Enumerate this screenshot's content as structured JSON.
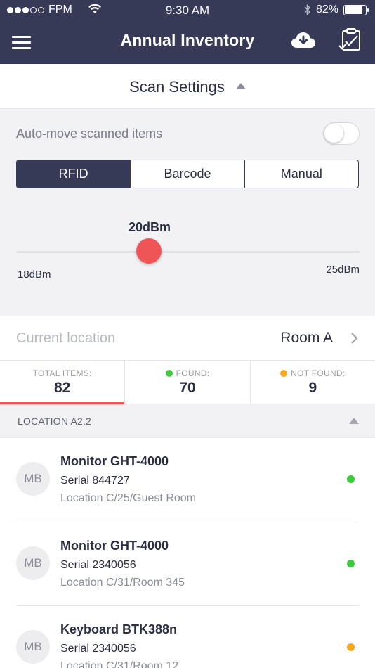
{
  "status_bar": {
    "carrier": "FPM",
    "time": "9:30 AM",
    "battery": "82%",
    "battery_level": 0.82,
    "signal_bars_filled": 3,
    "signal_bars_total": 5
  },
  "header": {
    "title": "Annual Inventory",
    "menu_icon": "hamburger-icon",
    "download_icon": "cloud-download-icon",
    "checklist_icon": "clipboard-check-icon",
    "background": "#363a56"
  },
  "scan_settings": {
    "title": "Scan Settings",
    "auto_move_label": "Auto-move scanned items",
    "auto_move_enabled": false,
    "modes": [
      {
        "label": "RFID",
        "active": true
      },
      {
        "label": "Barcode",
        "active": false
      },
      {
        "label": "Manual",
        "active": false
      }
    ],
    "power": {
      "value_label": "20dBm",
      "min_label": "18dBm",
      "max_label": "25dBm",
      "value": 20,
      "min": 18,
      "max": 25
    }
  },
  "location": {
    "label": "Current location",
    "value": "Room A"
  },
  "stats": [
    {
      "label": "TOTAL ITEMS:",
      "value": "82",
      "dot_color": null,
      "active": true
    },
    {
      "label": "FOUND:",
      "value": "70",
      "dot_color": "#3cc93c",
      "active": false
    },
    {
      "label": "NOT FOUND:",
      "value": "9",
      "dot_color": "#f5a623",
      "active": false
    }
  ],
  "section": {
    "title": "LOCATION A2.2"
  },
  "items": [
    {
      "initials": "MB",
      "name": "Monitor GHT-4000",
      "serial": "Serial 844727",
      "location": "Location C/25/Guest Room",
      "status_color": "#3cc93c"
    },
    {
      "initials": "MB",
      "name": "Monitor GHT-4000",
      "serial": "Serial 2340056",
      "location": "Location C/31/Room 345",
      "status_color": "#3cc93c"
    },
    {
      "initials": "MB",
      "name": "Keyboard BTK388n",
      "serial": "Serial 2340056",
      "location": "Location C/31/Room 12",
      "status_color": "#f5a623"
    }
  ],
  "colors": {
    "accent": "#ef5556",
    "primary": "#363a56",
    "found": "#3cc93c",
    "not_found": "#f5a623"
  }
}
